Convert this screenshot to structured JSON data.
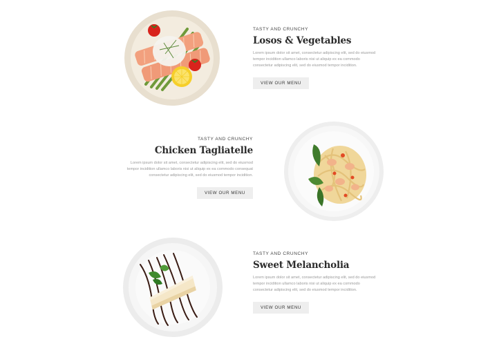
{
  "items": [
    {
      "kicker": "TASTY AND CRUNCHY",
      "title": "Losos & Vegetables",
      "desc_line1": "Lorem ipsum dolor sit amet, consectetur adipiscing elit, sed do eiusmod",
      "desc_line2": "tempor incidition ullamco laboris nisi ut aliquip ex ea commodo",
      "desc_line3": "consectetur adipiscing elit, sed do eiusmod tempor incidition.",
      "button": "VIEW OUR MENU"
    },
    {
      "kicker": "TASTY AND CRUNCHY",
      "title": "Chicken Tagliatelle",
      "desc_line1": "Lorem ipsum dolor sit amet, consectetur adipiscing elit, sed do eiusmod",
      "desc_line2": "tempor incidition ullamco laboris nisi ut aliquip ex ea commodo consequat",
      "desc_line3": "consectetur adipiscing elit, sed do eiusmod tempor incidition.",
      "button": "VIEW OUR MENU"
    },
    {
      "kicker": "TASTY AND CRUNCHY",
      "title": "Sweet Melancholia",
      "desc_line1": "Lorem ipsum dolor sit amet, consectetur adipiscing elit, sed do eiusmod",
      "desc_line2": "tempor incidition ullamco laboris nisi ut aliquip ex ea commodo",
      "desc_line3": "consectetur adipiscing elit, sed do eiusmod tempor incidition.",
      "button": "VIEW OUR MENU"
    }
  ],
  "colors": {
    "button_bg": "#eeeeee",
    "title": "#2b2b2b",
    "desc": "#9a9a9a"
  }
}
